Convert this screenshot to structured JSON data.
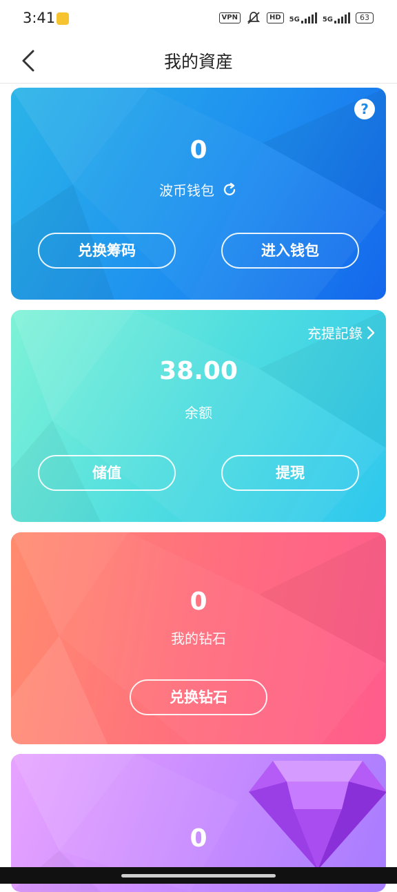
{
  "status_bar": {
    "time": "3:41",
    "vpn": "VPN",
    "hd": "HD",
    "net1": "5G",
    "net2": "5G",
    "battery": "63"
  },
  "nav": {
    "title": "我的資産",
    "back_icon": "chevron-left-icon"
  },
  "wallet_card": {
    "value": "0",
    "label": "波币钱包",
    "refresh_icon": "refresh-icon",
    "help_icon": "question-mark-icon",
    "help_glyph": "?",
    "buttons": {
      "exchange": "兑换筹码",
      "enter": "进入钱包"
    }
  },
  "balance_card": {
    "records_link": "充提記錄",
    "records_icon": "chevron-right-icon",
    "value": "38.00",
    "label": "余额",
    "buttons": {
      "deposit": "储值",
      "withdraw": "提現"
    }
  },
  "diamond_card": {
    "value": "0",
    "label": "我的钻石",
    "button": "兑换钻石"
  },
  "gem_card": {
    "value": "0",
    "gem_icon": "diamond-gem-icon"
  },
  "colors": {
    "wallet_card": "#1e8ff0",
    "balance_card": "#4fdde0",
    "diamond_card": "#ff6f7e",
    "gem_card": "#c88cff"
  }
}
